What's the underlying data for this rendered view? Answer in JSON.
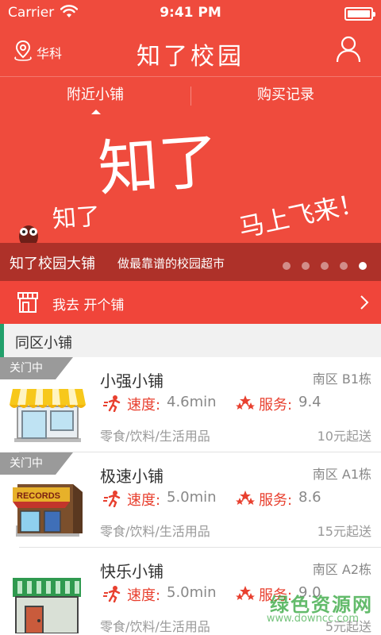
{
  "status_bar": {
    "carrier": "Carrier",
    "time": "9:41 PM"
  },
  "nav": {
    "location": "华科",
    "title": "知了校园"
  },
  "tabs": [
    {
      "label": "附近小铺",
      "selected": true
    },
    {
      "label": "购买记录",
      "selected": false
    }
  ],
  "banner": {
    "art_text_big": "知了",
    "art_text_small": "知了",
    "art_text_slogan": "马上飞来！",
    "caption_title": "知了校园大铺",
    "caption_subtitle": "做最靠谱的校园超市",
    "page_count": 5,
    "active_page": 5
  },
  "open_shop": {
    "label": "我去 开个铺"
  },
  "section": {
    "title": "同区小铺"
  },
  "shops": [
    {
      "status": "关门中",
      "name": "小强小铺",
      "location": "南区 B1栋",
      "speed_label": "速度:",
      "speed_value": "4.6min",
      "service_label": "服务:",
      "service_value": "9.4",
      "categories": "零食/饮料/生活用品",
      "min_order": "10元起送",
      "image_icon": "awning-store-icon"
    },
    {
      "status": "关门中",
      "name": "极速小铺",
      "location": "南区 A1栋",
      "speed_label": "速度:",
      "speed_value": "5.0min",
      "service_label": "服务:",
      "service_value": "8.6",
      "categories": "零食/饮料/生活用品",
      "min_order": "15元起送",
      "image_icon": "records-store-icon"
    },
    {
      "status": "",
      "name": "快乐小铺",
      "location": "南区 A2栋",
      "speed_label": "速度:",
      "speed_value": "5.0min",
      "service_label": "服务:",
      "service_value": "9.0",
      "categories": "零食/饮料/生活用品",
      "min_order": "5元起送",
      "image_icon": "green-store-icon"
    }
  ],
  "watermark": {
    "main": "绿色资源网",
    "sub": "www.downcc.com"
  },
  "colors": {
    "brand_red": "#ef4b3d",
    "accent_green": "#22a06b",
    "closed_tag_gray": "#9a9a9a"
  }
}
